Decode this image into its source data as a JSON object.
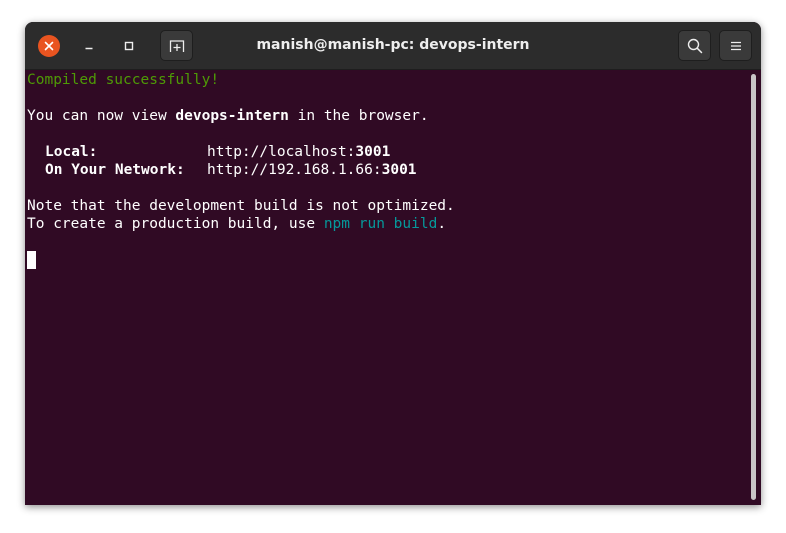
{
  "window": {
    "title": "manish@manish-pc: devops-intern"
  },
  "terminal": {
    "compiled": "Compiled successfully!",
    "view_prefix": "You can now view ",
    "app_name": "devops-intern",
    "view_suffix": " in the browser.",
    "local_label": "Local:",
    "local_url_prefix": "http://localhost:",
    "local_port": "3001",
    "network_label": "On Your Network:",
    "network_url_prefix": "http://192.168.1.66:",
    "network_port": "3001",
    "note_line": "Note that the development build is not optimized.",
    "prod_prefix": "To create a production build, use ",
    "prod_command": "npm run build",
    "prod_suffix": "."
  },
  "icons": {
    "close": "close-icon",
    "minimize": "minimize-icon",
    "maximize": "maximize-icon",
    "new_tab": "new-tab-icon",
    "search": "search-icon",
    "menu": "hamburger-menu-icon"
  },
  "colors": {
    "terminal_background": "#300a24",
    "titlebar_background": "#2c2c2c",
    "close_button": "#e95420",
    "success_text": "#4e9a06",
    "command_text": "#06989a"
  }
}
